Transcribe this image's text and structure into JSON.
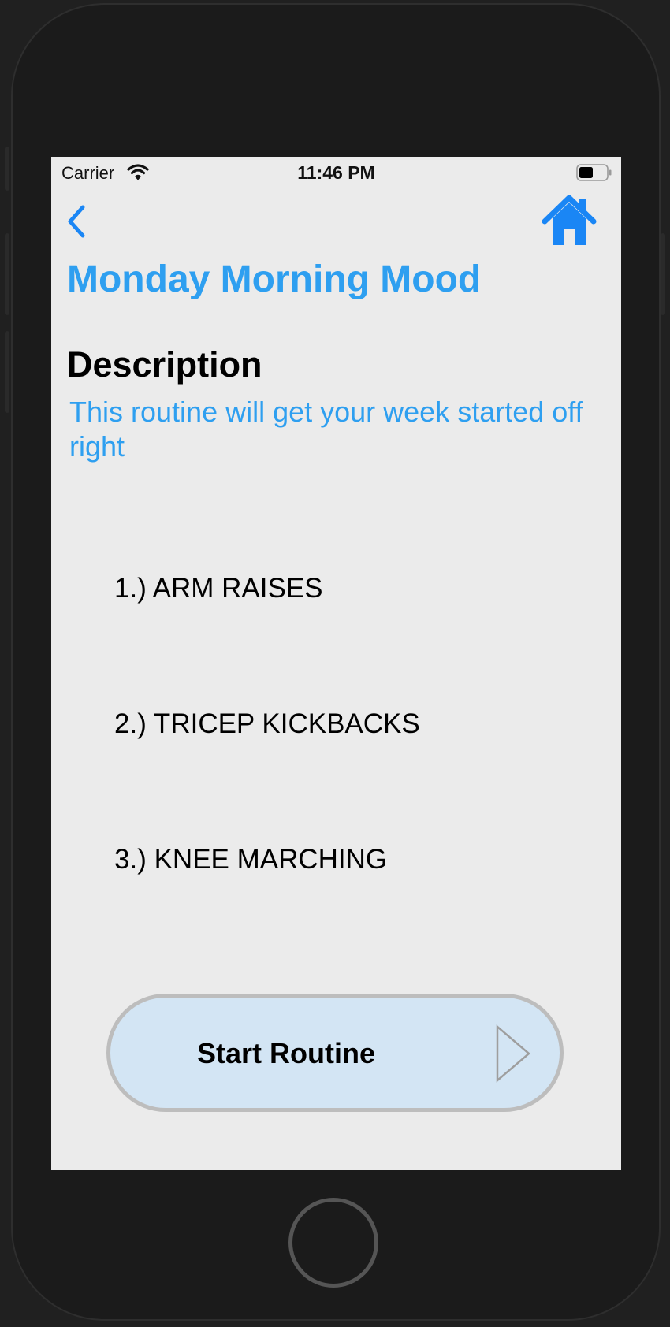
{
  "status_bar": {
    "carrier": "Carrier",
    "time": "11:46 PM"
  },
  "nav": {
    "back_icon": "chevron-left-icon",
    "home_icon": "house-icon"
  },
  "routine": {
    "title": "Monday Morning Mood",
    "description_heading": "Description",
    "description": "This routine will get your week started off right",
    "exercises": [
      "1.) ARM RAISES",
      "2.) TRICEP KICKBACKS",
      "3.) KNEE MARCHING"
    ]
  },
  "start_button": {
    "label": "Start Routine",
    "icon": "play-icon"
  },
  "colors": {
    "accent": "#2e9ff0",
    "icon_blue": "#1a86f5",
    "screen_background": "#ebebeb",
    "button_background": "#d3e5f4"
  }
}
